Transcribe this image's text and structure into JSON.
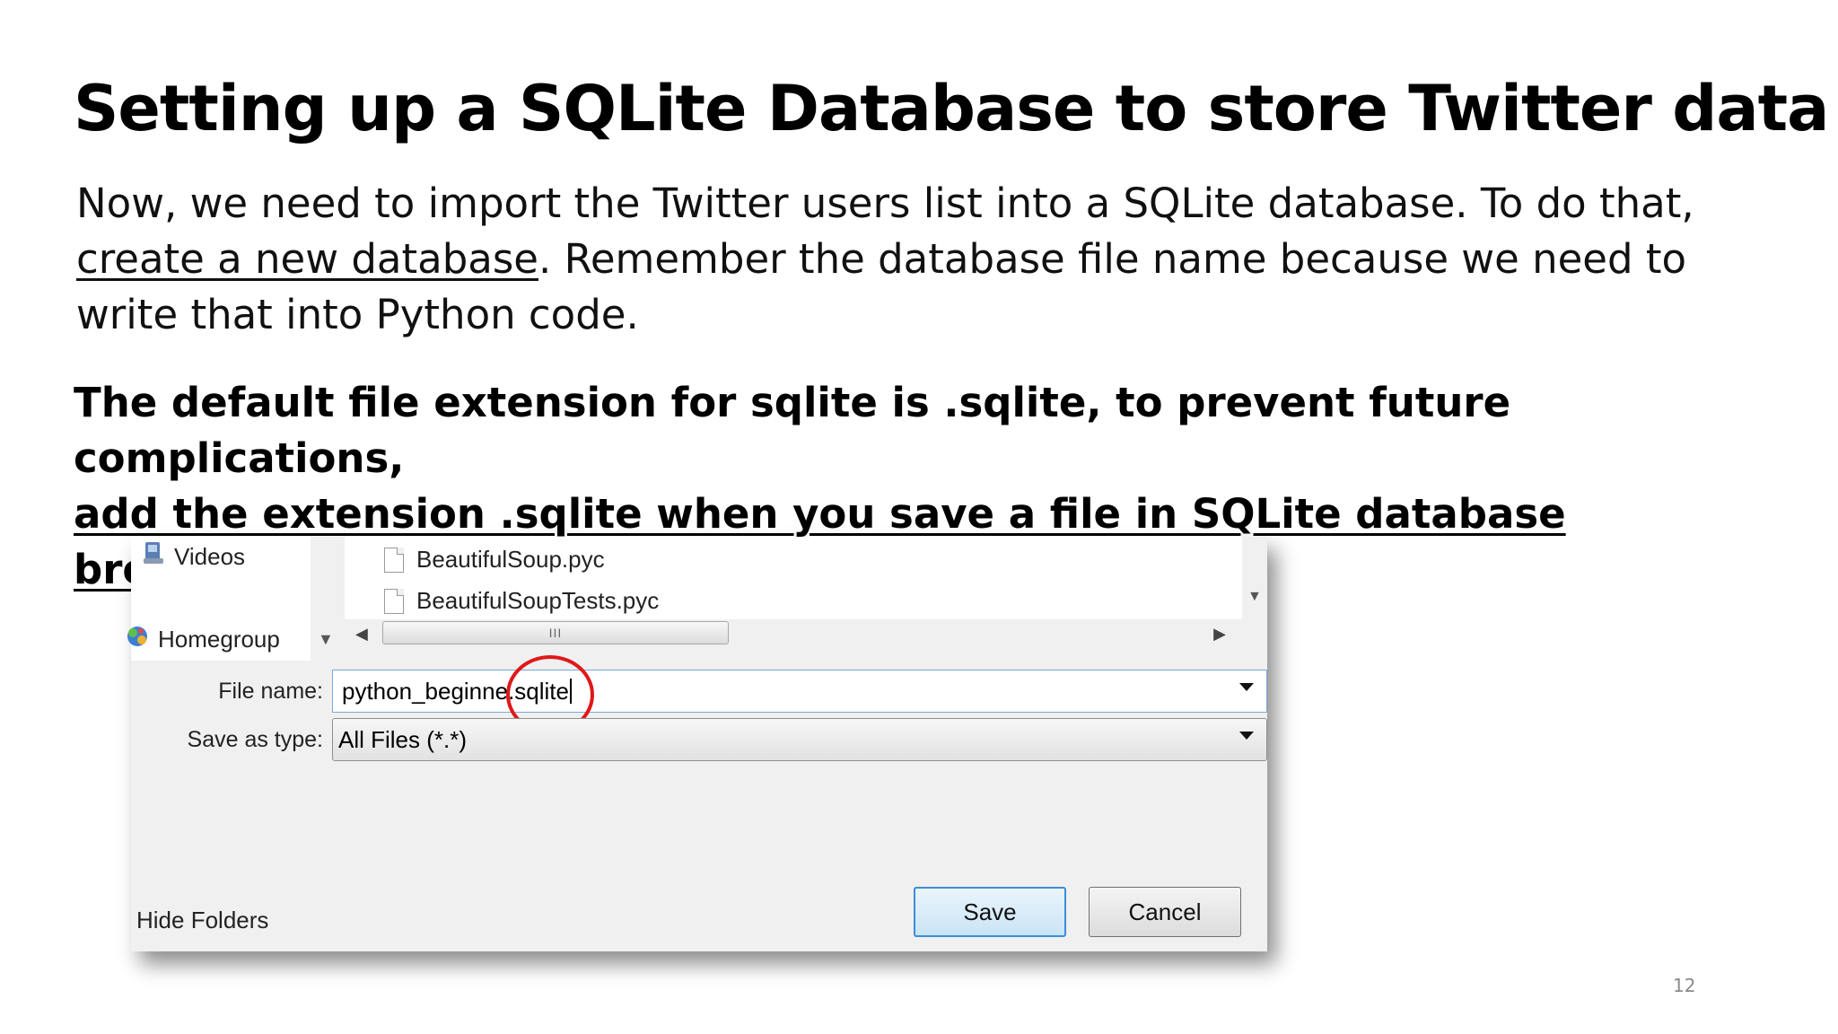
{
  "slide": {
    "title": "Setting up a SQLite Database to store Twitter data",
    "paragraph_part1": "Now, we need to import the Twitter users list into a SQLite database. To do that, ",
    "paragraph_link": "create a new database",
    "paragraph_part2": ". Remember the database file name because we need to write that into Python code.",
    "note_line1": "The default file extension for sqlite is .sqlite, to prevent future complications,",
    "note_line2": "add the extension .sqlite when you save a file in SQLite database browser,.",
    "page_number": "12"
  },
  "dialog": {
    "nav_items": [
      {
        "label": "Videos",
        "icon": "videos-library-icon"
      },
      {
        "label": "Homegroup",
        "icon": "homegroup-icon"
      }
    ],
    "files": [
      {
        "name": "BeautifulSoup.pyc",
        "icon": "document-icon"
      },
      {
        "name": "BeautifulSoupTests.pyc",
        "icon": "document-icon"
      }
    ],
    "hscroll_thumb_grip": "III",
    "file_name_label": "File name:",
    "file_name_value": "python_beginner.sqlite",
    "file_name_value_prefix": "python_beginne",
    "file_name_value_suffix": ".sqlite",
    "save_as_type_label": "Save as type:",
    "save_as_type_value": "All Files (*.*)",
    "save_button": "Save",
    "cancel_button": "Cancel",
    "hide_folders": "Hide Folders",
    "highlight_color": "#e01818"
  }
}
